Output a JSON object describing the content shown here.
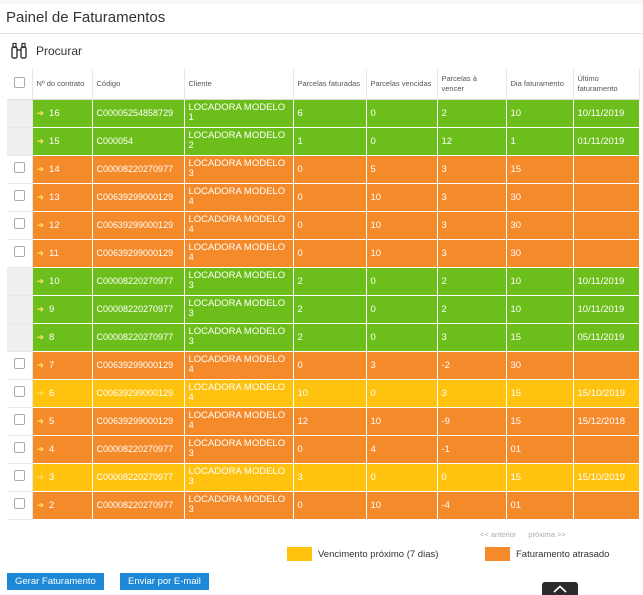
{
  "page": {
    "title": "Painel de Faturamentos"
  },
  "search": {
    "label": "Procurar"
  },
  "table": {
    "headers": [
      "Nº do contrato",
      "Código",
      "Cliente",
      "Parcelas faturadas",
      "Parcelas vencidas",
      "Parcelas à vencer",
      "Dia faturamento",
      "Último faturamento"
    ],
    "rows": [
      {
        "status": "green",
        "has_checkbox": false,
        "contract": "16",
        "code": "C00005254858729",
        "client_name": "LOCADORA MODELO",
        "client_num": "1",
        "billed": "6",
        "overdue": "0",
        "to_due": "2",
        "day": "10",
        "last": "10/11/2019"
      },
      {
        "status": "green",
        "has_checkbox": false,
        "contract": "15",
        "code": "C000054",
        "client_name": "LOCADORA MODELO",
        "client_num": "2",
        "billed": "1",
        "overdue": "0",
        "to_due": "12",
        "day": "1",
        "last": "01/11/2019"
      },
      {
        "status": "orange",
        "has_checkbox": true,
        "contract": "14",
        "code": "C00008220270977",
        "client_name": "LOCADORA MODELO",
        "client_num": "3",
        "billed": "0",
        "overdue": "5",
        "to_due": "3",
        "day": "15",
        "last": ""
      },
      {
        "status": "orange",
        "has_checkbox": true,
        "contract": "13",
        "code": "C00639299000129",
        "client_name": "LOCADORA MODELO",
        "client_num": "4",
        "billed": "0",
        "overdue": "10",
        "to_due": "3",
        "day": "30",
        "last": ""
      },
      {
        "status": "orange",
        "has_checkbox": true,
        "contract": "12",
        "code": "C00639299000129",
        "client_name": "LOCADORA MODELO",
        "client_num": "4",
        "billed": "0",
        "overdue": "10",
        "to_due": "3",
        "day": "30",
        "last": ""
      },
      {
        "status": "orange",
        "has_checkbox": true,
        "contract": "11",
        "code": "C00639299000129",
        "client_name": "LOCADORA MODELO",
        "client_num": "4",
        "billed": "0",
        "overdue": "10",
        "to_due": "3",
        "day": "30",
        "last": ""
      },
      {
        "status": "green",
        "has_checkbox": false,
        "contract": "10",
        "code": "C00008220270977",
        "client_name": "LOCADORA MODELO",
        "client_num": "3",
        "billed": "2",
        "overdue": "0",
        "to_due": "2",
        "day": "10",
        "last": "10/11/2019"
      },
      {
        "status": "green",
        "has_checkbox": false,
        "contract": "9",
        "code": "C00008220270977",
        "client_name": "LOCADORA MODELO",
        "client_num": "3",
        "billed": "2",
        "overdue": "0",
        "to_due": "2",
        "day": "10",
        "last": "10/11/2019"
      },
      {
        "status": "green",
        "has_checkbox": false,
        "contract": "8",
        "code": "C00008220270977",
        "client_name": "LOCADORA MODELO",
        "client_num": "3",
        "billed": "2",
        "overdue": "0",
        "to_due": "3",
        "day": "15",
        "last": "05/11/2019"
      },
      {
        "status": "orange",
        "has_checkbox": true,
        "contract": "7",
        "code": "C00639299000129",
        "client_name": "LOCADORA MODELO",
        "client_num": "4",
        "billed": "0",
        "overdue": "3",
        "to_due": "-2",
        "day": "30",
        "last": ""
      },
      {
        "status": "yellow",
        "has_checkbox": true,
        "contract": "6",
        "code": "C00639299000129",
        "client_name": "LOCADORA MODELO",
        "client_num": "4",
        "billed": "10",
        "overdue": "0",
        "to_due": "3",
        "day": "15",
        "last": "15/10/2019"
      },
      {
        "status": "orange",
        "has_checkbox": true,
        "contract": "5",
        "code": "C00639299000129",
        "client_name": "LOCADORA MODELO",
        "client_num": "4",
        "billed": "12",
        "overdue": "10",
        "to_due": "-9",
        "day": "15",
        "last": "15/12/2018"
      },
      {
        "status": "orange",
        "has_checkbox": true,
        "contract": "4",
        "code": "C00008220270977",
        "client_name": "LOCADORA MODELO",
        "client_num": "3",
        "billed": "0",
        "overdue": "4",
        "to_due": "-1",
        "day": "01",
        "last": ""
      },
      {
        "status": "yellow",
        "has_checkbox": true,
        "contract": "3",
        "code": "C00008220270977",
        "client_name": "LOCADORA MODELO",
        "client_num": "3",
        "billed": "3",
        "overdue": "0",
        "to_due": "0",
        "day": "15",
        "last": "15/10/2019"
      },
      {
        "status": "orange",
        "has_checkbox": true,
        "contract": "2",
        "code": "C00008220270977",
        "client_name": "LOCADORA MODELO",
        "client_num": "3",
        "billed": "0",
        "overdue": "10",
        "to_due": "-4",
        "day": "01",
        "last": ""
      }
    ]
  },
  "pagination": {
    "previous": "<< anterior",
    "next": "próxima >>"
  },
  "legend": [
    {
      "label": "Vencimento próximo (7 dias)",
      "color": "#ffc20e"
    },
    {
      "label": "Faturamento atrasado",
      "color": "#f58a2a"
    }
  ],
  "colors": {
    "green": "#6cbf1a",
    "orange": "#f58a2a",
    "yellow": "#ffc20e",
    "button": "#1e88d8"
  },
  "icons": {
    "search": "binoculars-icon",
    "row_marker": "arrow-right-icon",
    "scroll_top": "chevron-up-icon"
  },
  "buttons": {
    "generate": "Gerar Faturamento",
    "email": "Enviar por E-mail"
  }
}
